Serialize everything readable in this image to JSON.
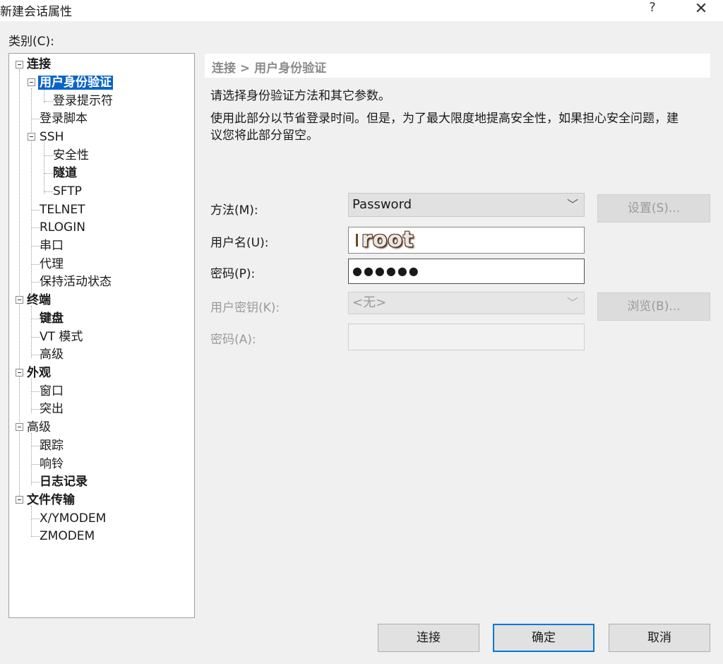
{
  "window": {
    "title": "新建会话属性",
    "help": "?",
    "close": "✕"
  },
  "category_label": "类别(C):",
  "tree": {
    "connection": "连接",
    "auth": "用户身份验证",
    "login_prompt": "登录提示符",
    "login_script": "登录脚本",
    "ssh": "SSH",
    "security": "安全性",
    "tunnel": "隧道",
    "sftp": "SFTP",
    "telnet": "TELNET",
    "rlogin": "RLOGIN",
    "serial": "串口",
    "proxy": "代理",
    "keepalive": "保持活动状态",
    "terminal": "终端",
    "keyboard": "键盘",
    "vt_mode": "VT 模式",
    "advanced_term": "高级",
    "appearance": "外观",
    "window_item": "窗口",
    "highlight": "突出",
    "advanced": "高级",
    "trace": "跟踪",
    "bell": "响铃",
    "logging": "日志记录",
    "file_transfer": "文件传输",
    "xymodem": "X/YMODEM",
    "zmodem": "ZMODEM"
  },
  "panel": {
    "breadcrumb": "连接 > 用户身份验证",
    "desc1": "请选择身份验证方法和其它参数。",
    "desc2_line1": "使用此部分以节省登录时间。但是，为了最大限度地提高安全性，如果担心安全问题，建",
    "desc2_line2": "议您将此部分留空。"
  },
  "form": {
    "method_label": "方法(M):",
    "method_value": "Password",
    "username_label": "用户名(U):",
    "username_value": "root",
    "password_label": "密码(P):",
    "password_value": "●●●●●●",
    "userkey_label": "用户密钥(K):",
    "userkey_value": "<无>",
    "passphrase_label": "密码(A):",
    "settings_button": "设置(S)...",
    "browse_button": "浏览(B)..."
  },
  "buttons": {
    "connect": "连接",
    "ok": "确定",
    "cancel": "取消"
  }
}
